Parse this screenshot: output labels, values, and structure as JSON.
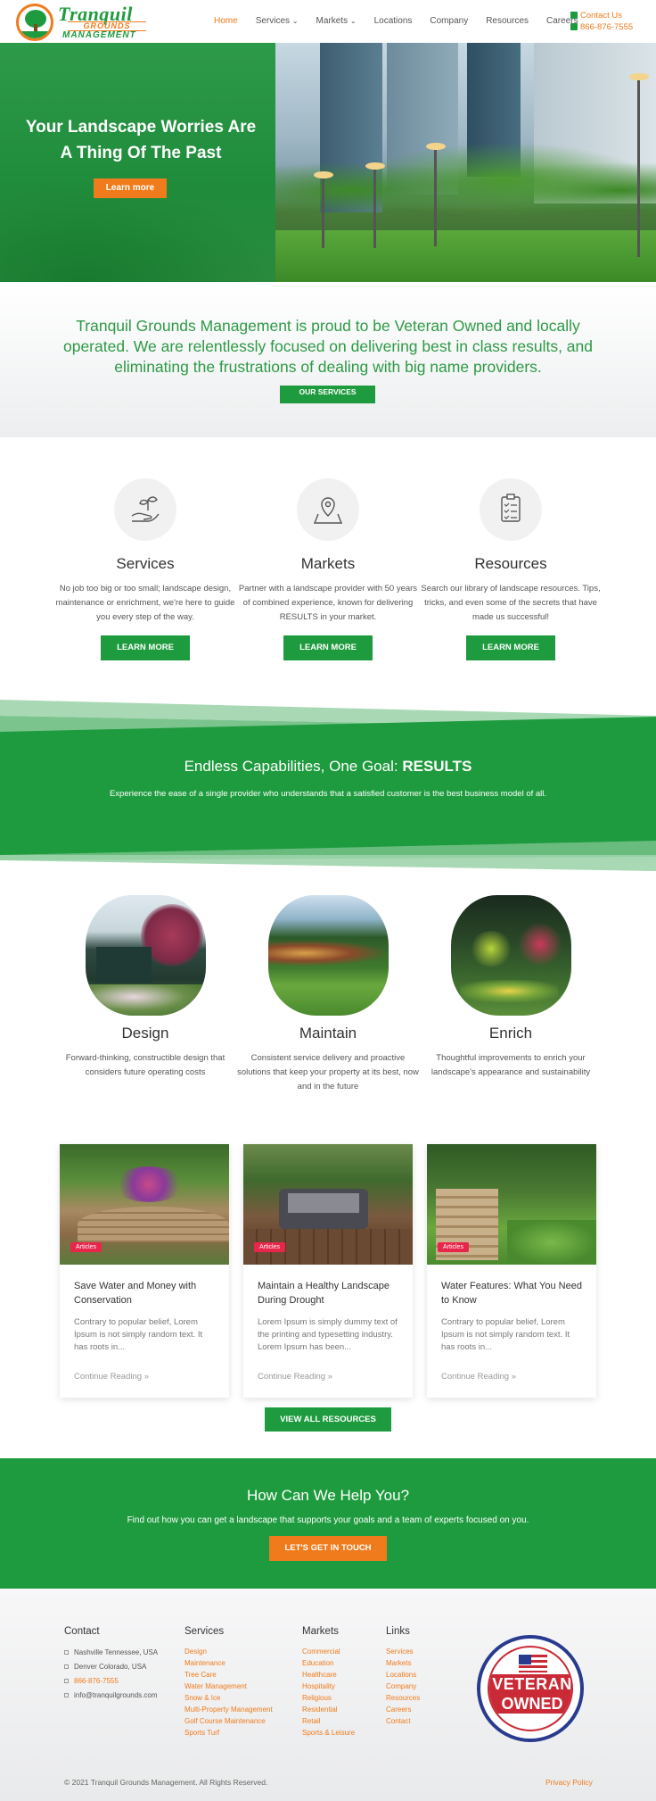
{
  "brand": {
    "name_line1": "Tranquil",
    "name_line2": "GROUNDS",
    "name_line3": "MANAGEMENT",
    "accent": "#f07b1c",
    "green": "#1e9b3e"
  },
  "nav": {
    "items": [
      "Home",
      "Services",
      "Markets",
      "Locations",
      "Company",
      "Resources",
      "Careers"
    ],
    "dropdown_markers": [
      "",
      "⌄",
      "⌄",
      "",
      "",
      "",
      ""
    ]
  },
  "header_contact": {
    "contact_label": "Contact Us",
    "phone": "866-876-7555"
  },
  "hero": {
    "title": "Your Landscape Worries Are A Thing Of The Past",
    "button": "Learn more"
  },
  "intro": {
    "text": "Tranquil Grounds Management is proud to be Veteran Owned and locally operated. We are relentlessly focused on delivering best in class results, and eliminating the frustrations of dealing with big name providers.",
    "button": "OUR SERVICES"
  },
  "features": [
    {
      "icon": "hand-plant-icon",
      "title": "Services",
      "text": "No job too big or too small; landscape design, maintenance or enrichment, we're here to guide you every step of the way.",
      "button": "LEARN MORE"
    },
    {
      "icon": "map-pin-icon",
      "title": "Markets",
      "text": "Partner with a landscape provider with 50 years of combined experience, known for delivering RESULTS in your market.",
      "button": "LEARN MORE"
    },
    {
      "icon": "checklist-icon",
      "title": "Resources",
      "text": "Search our library of landscape resources. Tips, tricks, and even some of the secrets that have made us successful!",
      "button": "LEARN MORE"
    }
  ],
  "band": {
    "title_prefix": "Endless Capabilities, One Goal: ",
    "title_bold": "RESULTS",
    "subtitle": "Experience the ease of a single provider who understands that a satisfied customer is the best business model of all."
  },
  "pillars": [
    {
      "title": "Design",
      "text": "Forward-thinking, constructible design that considers future operating costs"
    },
    {
      "title": "Maintain",
      "text": "Consistent service delivery and proactive solutions that keep your property at its best, now and in the future"
    },
    {
      "title": "Enrich",
      "text": "Thoughtful improvements to enrich your landscape's appearance and sustainability"
    }
  ],
  "articles": [
    {
      "tag": "Articles",
      "title": "Save Water and Money with Conservation",
      "excerpt": "Contrary to popular belief, Lorem Ipsum is not simply random text. It has roots in...",
      "more": "Continue Reading »"
    },
    {
      "tag": "Articles",
      "title": "Maintain a Healthy Landscape During Drought",
      "excerpt": "Lorem Ipsum is simply dummy text of the printing and typesetting industry. Lorem Ipsum has been...",
      "more": "Continue Reading »"
    },
    {
      "tag": "Articles",
      "title": "Water Features: What You Need to Know",
      "excerpt": "Contrary to popular belief, Lorem Ipsum is not simply random text. It has roots in...",
      "more": "Continue Reading »"
    }
  ],
  "view_all": "VIEW ALL RESOURCES",
  "cta": {
    "title": "How Can We Help You?",
    "text": "Find out how you can get a landscape that supports your goals and a team of experts focused on you.",
    "button": "LET'S GET IN TOUCH"
  },
  "footer": {
    "contact": {
      "heading": "Contact",
      "items": [
        "Nashville Tennessee, USA",
        "Denver Colorado, USA",
        "866-876-7555",
        "info@tranquilgrounds.com"
      ]
    },
    "services": {
      "heading": "Services",
      "items": [
        "Design",
        "Maintenance",
        "Tree Care",
        "Water Management",
        "Snow & Ice",
        "Multi-Property Management",
        "Golf Course Maintenance",
        "Sports Turf"
      ]
    },
    "markets": {
      "heading": "Markets",
      "items": [
        "Commercial",
        "Education",
        "Healthcare",
        "Hospitality",
        "Religious",
        "Residential",
        "Retail",
        "Sports & Leisure"
      ]
    },
    "links": {
      "heading": "Links",
      "items": [
        "Services",
        "Markets",
        "Locations",
        "Company",
        "Resources",
        "Careers",
        "Contact"
      ]
    },
    "badge": {
      "line1": "VETERAN",
      "line2": "OWNED"
    },
    "copyright": "© 2021 Tranquil Grounds Management. All Rights Reserved.",
    "privacy": "Privacy Policy"
  }
}
